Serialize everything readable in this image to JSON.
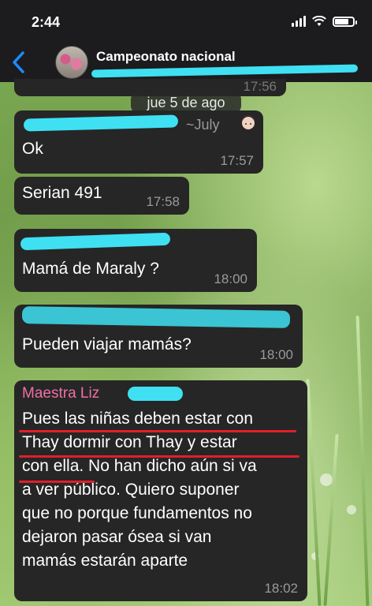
{
  "status_bar": {
    "time": "2:44"
  },
  "header": {
    "back_icon": "chevron-left-icon",
    "title": "Campeonato nacional"
  },
  "chat": {
    "top_timestamp": "17:56",
    "date_separator": "jue 5 de ago",
    "messages": [
      {
        "sender_suffix": "~July",
        "text": "Ok",
        "time": "17:57"
      },
      {
        "text": "Serian 491",
        "time": "17:58"
      },
      {
        "text": "Mamá de Maraly ?",
        "time": "18:00"
      },
      {
        "text": "Pueden viajar mamás?",
        "time": "18:00"
      },
      {
        "sender": "Maestra Liz",
        "lines": [
          "Pues las niñas deben estar con",
          "Thay  dormir con Thay y  estar",
          "con ella. No han dicho aún si va",
          "a ver público.  Quiero suponer",
          "que no porque fundamentos no",
          "dejaron pasar  ósea si van",
          "mamás estarán aparte"
        ],
        "time": "18:02"
      }
    ]
  },
  "colors": {
    "accent": "#1e8bff",
    "bubble": "#262626",
    "sender_pink": "#f06fa5",
    "redaction": "#3fe0f2",
    "underline": "#e01f2a"
  }
}
